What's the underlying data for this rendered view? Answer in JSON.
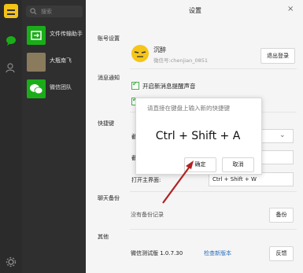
{
  "search": {
    "label": "搜索"
  },
  "chats": [
    {
      "name": "文件传输助手",
      "avatar_color": "#1aad19"
    },
    {
      "name": "大瓶南飞",
      "avatar_color": "#8a7b5c"
    },
    {
      "name": "微信团队",
      "avatar_color": "#1aad19"
    }
  ],
  "settings": {
    "title": "设置",
    "sections": {
      "account": "账号设置",
      "notify": "消息通知",
      "shortcut": "快捷键",
      "backup": "聊天备份",
      "other": "其他"
    },
    "account": {
      "name": "沉醉",
      "wxid": "微信号:chenjian_0851",
      "logout_label": "退出登录"
    },
    "notify": {
      "option1": "开启新消息提醒声音",
      "option1_checked": true,
      "option2_checked": true
    },
    "shortcut": {
      "row1_label": "截",
      "row2_label": "截",
      "open_main_label": "打开主界面:",
      "open_main_value": "Ctrl + Shift + W"
    },
    "backup": {
      "empty_text": "没有备份记录",
      "button_label": "备份"
    },
    "other": {
      "version": "微信测试版 1.0.7.30",
      "check_update": "检查新版本",
      "feedback_label": "反馈"
    }
  },
  "dialog": {
    "prompt": "请直接在键盘上输入新的快捷键",
    "combo": "Ctrl + Shift + A",
    "ok_label": "确定",
    "cancel_label": "取消"
  },
  "colors": {
    "accent_green": "#1aad19",
    "arrow": "#b22222",
    "link": "#2a6fbd"
  }
}
